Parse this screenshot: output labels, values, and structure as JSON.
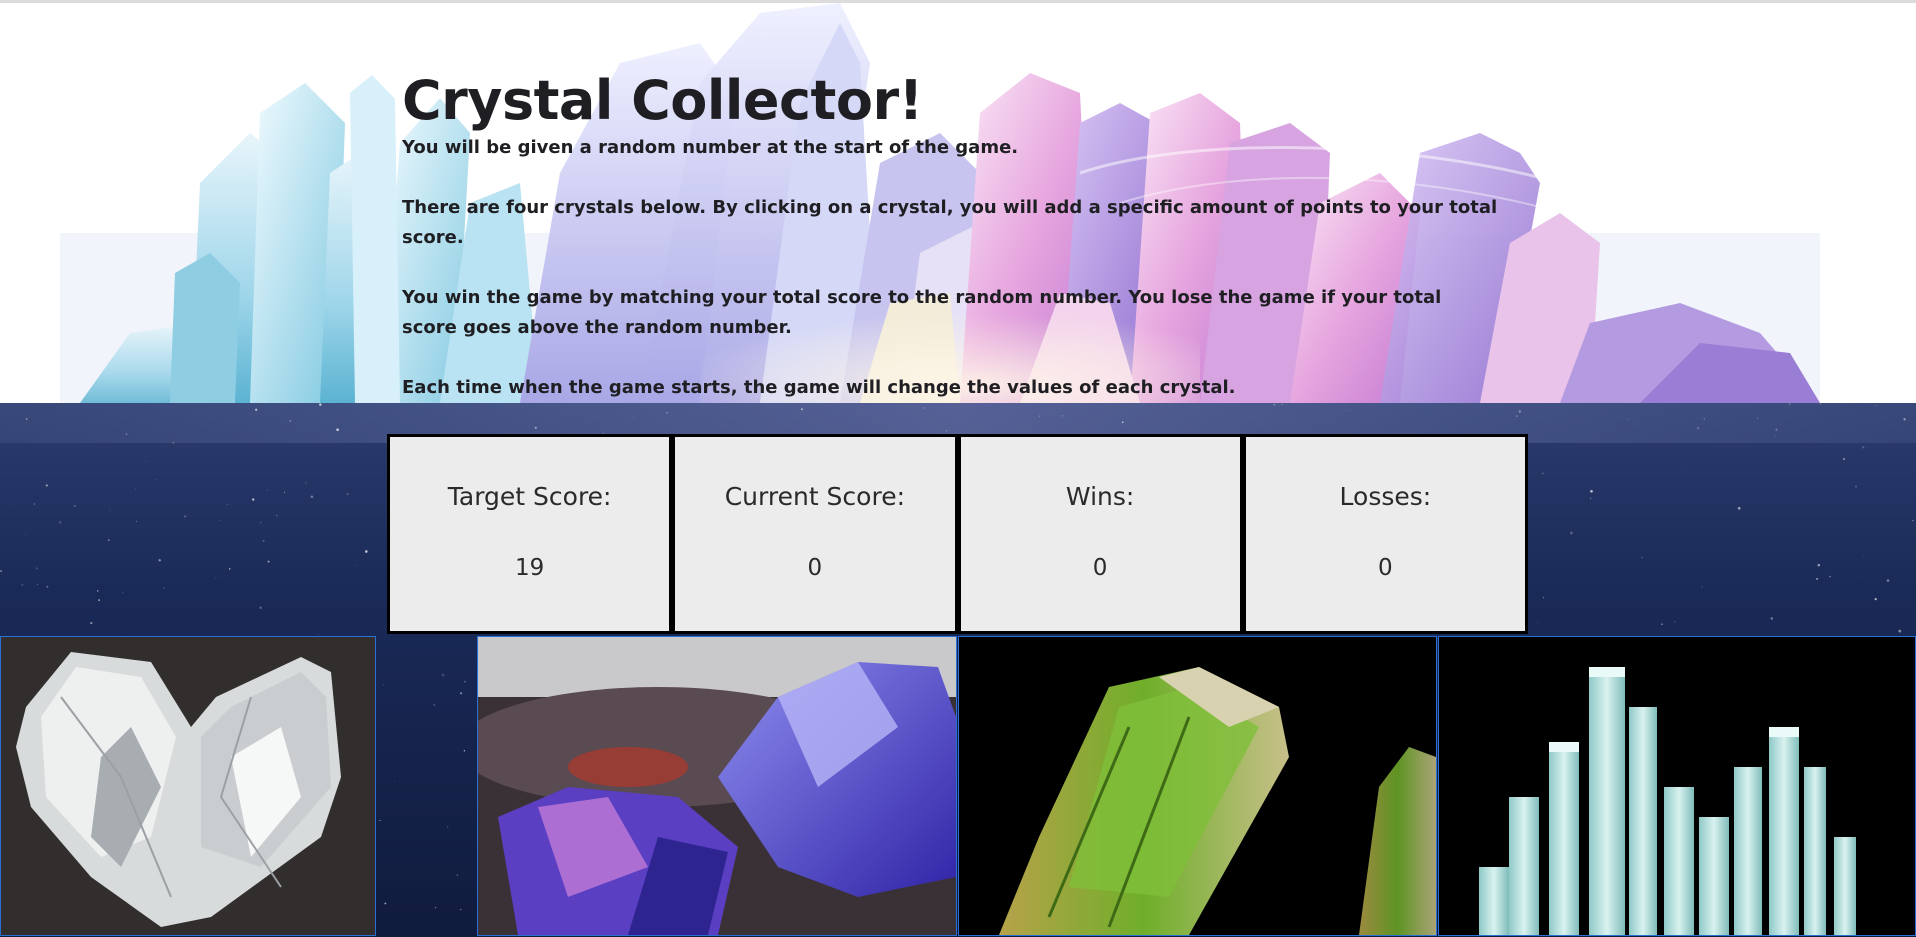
{
  "header": {
    "title": "Crystal Collector!",
    "paragraphs": [
      "You will be given a random number at the start of the game.",
      "There are four crystals below. By clicking on a crystal, you will add a specific amount of points to your total score.",
      "You win the game by matching your total score to the random number. You lose the game if your total score goes above the random number.",
      "Each time when the game starts, the game will change the values of each crystal."
    ]
  },
  "scoreboard": {
    "target": {
      "label": "Target Score:",
      "value": "19"
    },
    "current": {
      "label": "Current Score:",
      "value": "0"
    },
    "wins": {
      "label": "Wins:",
      "value": "0"
    },
    "losses": {
      "label": "Losses:",
      "value": "0"
    }
  },
  "crystals": [
    {
      "icon": "clear-quartz-crystal"
    },
    {
      "icon": "blue-tanzanite-crystal"
    },
    {
      "icon": "green-tourmaline-crystal"
    },
    {
      "icon": "aquamarine-cluster-crystal"
    }
  ],
  "colors": {
    "text": "#1f1f23",
    "scorebox_bg": "#ececec",
    "crystal_border": "#2a6fd6",
    "space_bg": "#14234a"
  }
}
